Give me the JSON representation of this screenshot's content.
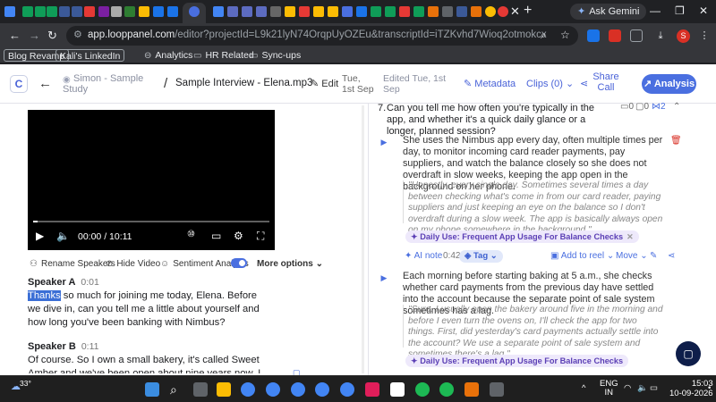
{
  "browser": {
    "ask_gemini": "Ask Gemini",
    "url_domain": "app.looppanel.com",
    "url_path": "/editor?projectId=L9k21lyN74OrqpUyOZEu&transcriptId=iTZKvhd7Wioq2otmokcx",
    "bookmarks": [
      "Blog Revamp",
      "Kali's LinkedIn",
      "Analytics",
      "HR Related",
      "Sync-ups"
    ],
    "profile_initial": "S"
  },
  "app": {
    "logo": "C",
    "study_name": "Simon - Sample Study",
    "doc_title": "Sample Interview - Elena.mp3",
    "edit_label": "Edit",
    "date_created": "Tue, 1st Sep",
    "date_edited": "Edited Tue, 1st Sep",
    "metadata_label": "Metadata",
    "clips_label": "Clips (0)",
    "share_label": "Share Call",
    "analysis_label": "Analysis"
  },
  "video": {
    "time": "00:00 / 10:11",
    "progress": 0.02
  },
  "video_options": {
    "rename": "Rename Speakers",
    "hide": "Hide Video",
    "sentiment": "Sentiment Analysis",
    "more": "More options"
  },
  "transcript": {
    "a_name": "Speaker A",
    "a_time": "0:01",
    "a_highlight": "Thanks",
    "a_text": " so much for joining me today, Elena. Before we dive in, can you tell me a little about yourself and how long you've been banking with Nimbus?",
    "b_name": "Speaker B",
    "b_time": "0:11",
    "b_text": "Of course. So I own a small bakery, it's called Sweet Amber and we've been open about nine years now. I personally banked with"
  },
  "notes": {
    "q_num": "7.",
    "q_text": "Can you tell me how often you're typically in the app, and whether it's a quick daily glance or a longer, planned session?",
    "q_meta1": "0",
    "q_meta2": "0",
    "q_meta3": "2",
    "answer1": "She uses the Nimbus app every day, often multiple times per day, to monitor incoming card reader payments, pay suppliers, and watch the balance closely so she does not overdraft in slow weeks, keeping the app open in the background on her phone.",
    "quote1": "\"Honestly, every single day. Sometimes several times a day between checking what's come in from our card reader, paying suppliers and just keeping an eye on the balance so I don't overdraft during a slow week. The app is basically always open on my phone somewhere in the background.\"",
    "chip1": "Daily Use: Frequent App Usage For Balance Checks",
    "ai_note": "AI note",
    "time1": "0:42",
    "tag_label": "Tag",
    "add_reel": "Add to reel",
    "move": "Move",
    "answer2": "Each morning before starting baking at 5 a.m., she checks whether card payments from the previous day have settled into the account because the separate point of sale system sometimes has a lag.",
    "quote2": "\"Sure. I usually open the bakery around five in the morning and before I even turn the ovens on, I'll check the app for two things. First, did yesterday's card payments actually settle into the account? We use a separate point of sale system and sometimes there's a lag.\"",
    "chip2": "Daily Use: Frequent App Usage For Balance Checks"
  },
  "taskbar": {
    "weather": "33°",
    "lang1": "ENG",
    "lang2": "IN",
    "time": "15:03",
    "date": "10-09-2026"
  }
}
